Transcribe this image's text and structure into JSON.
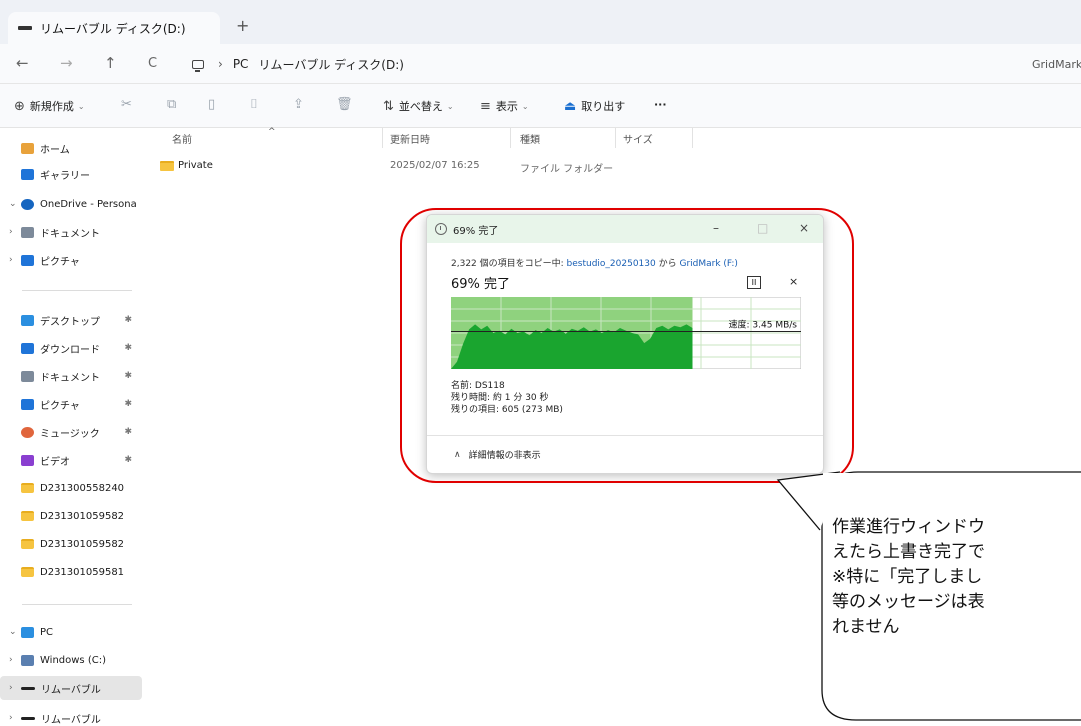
{
  "window": {
    "tab_title": "リムーバブル ディスク(D:)",
    "new_tab": "+"
  },
  "nav": {
    "back": "←",
    "forward": "→",
    "up": "↑",
    "refresh": "C",
    "breadcrumb": [
      "PC",
      "リムーバブル ディスク(D:)"
    ],
    "search_placeholder": "GridMark"
  },
  "toolbar": {
    "new_label": "新規作成",
    "sort_label": "並べ替え",
    "view_label": "表示",
    "eject_label": "取り出す",
    "more_label": "···"
  },
  "sidebar": {
    "top_items": [
      {
        "label": "ホーム",
        "icon": "home-icon"
      },
      {
        "label": "ギャラリー",
        "icon": "gallery-icon"
      },
      {
        "label": "OneDrive - Persona",
        "icon": "onedrive-icon"
      },
      {
        "label": "ドキュメント",
        "icon": "documents-icon"
      },
      {
        "label": "ピクチャ",
        "icon": "pictures-icon"
      }
    ],
    "quick_items": [
      {
        "label": "デスクトップ",
        "icon": "desktop-icon"
      },
      {
        "label": "ダウンロード",
        "icon": "download-icon"
      },
      {
        "label": "ドキュメント",
        "icon": "documents-icon"
      },
      {
        "label": "ピクチャ",
        "icon": "pictures-icon"
      },
      {
        "label": "ミュージック",
        "icon": "music-icon"
      },
      {
        "label": "ビデオ",
        "icon": "video-icon"
      },
      {
        "label": "D231300558240",
        "icon": "folder-icon"
      },
      {
        "label": "D231301059582",
        "icon": "folder-icon"
      },
      {
        "label": "D231301059582",
        "icon": "folder-icon"
      },
      {
        "label": "D231301059581",
        "icon": "folder-icon"
      }
    ],
    "pc_items": [
      {
        "label": "PC",
        "icon": "pc-icon"
      },
      {
        "label": "Windows (C:)",
        "icon": "drive-icon"
      },
      {
        "label": "リムーバブル",
        "icon": "removable-drive-icon"
      },
      {
        "label": "リムーバブル",
        "icon": "removable-drive-icon"
      }
    ]
  },
  "file_list": {
    "columns": [
      "名前",
      "更新日時",
      "種類",
      "サイズ"
    ],
    "rows": [
      {
        "name": "Private",
        "modified": "2025/02/07 16:25",
        "type": "ファイル フォルダー",
        "size": ""
      }
    ]
  },
  "progress_dialog": {
    "title": "69% 完了",
    "copy_prefix": "2,322 個の項目をコピー中: ",
    "source": "bestudio_20250130",
    "copy_middle": " から ",
    "destination": "GridMark (F:)",
    "percent_text": "69% 完了",
    "progress": 0.69,
    "speed": "速度: 3.45 MB/s",
    "name_line": "名前: DS118",
    "time_line": "残り時間: 約 1 分 30 秒",
    "items_line": "残りの項目: 605 (273 MB)",
    "toggle_label": "詳細情報の非表示",
    "pause_glyph": "II",
    "stop_glyph": "×",
    "minimize_glyph": "–",
    "maximize_glyph": "□",
    "close_glyph": "×",
    "speed_history": [
      0.0,
      0.1,
      0.35,
      0.55,
      0.62,
      0.55,
      0.6,
      0.5,
      0.53,
      0.48,
      0.56,
      0.5,
      0.52,
      0.47,
      0.54,
      0.5,
      0.57,
      0.52,
      0.55,
      0.49,
      0.56,
      0.53,
      0.58,
      0.52,
      0.55,
      0.5,
      0.54,
      0.51,
      0.57,
      0.53,
      0.5,
      0.48,
      0.36,
      0.42,
      0.57,
      0.6,
      0.55,
      0.6,
      0.58,
      0.62,
      0.57
    ],
    "avg_level": 0.52
  },
  "callout": {
    "text": "作業進行ウィンドウ\nえたら上書き完了で\n※特に「完了しまし\n等のメッセージは表\nれません"
  },
  "colors": {
    "accent_green": "#8fd27e",
    "graph_fill": "#1aa52f",
    "highlight": "#e00000",
    "link": "#1a5fb4"
  }
}
